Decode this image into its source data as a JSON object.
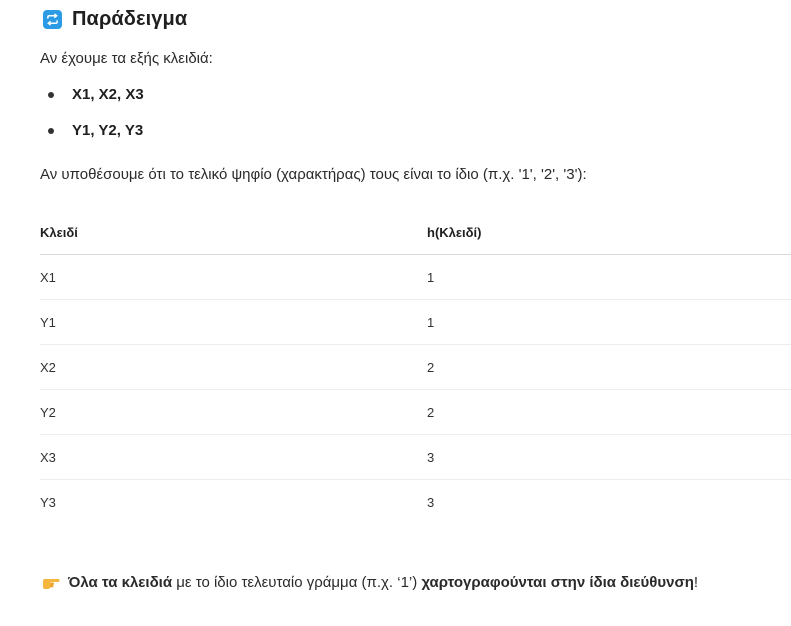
{
  "heading": {
    "icon": "repeat-icon",
    "icon_color": "#2b9be6",
    "title": "Παράδειγμα"
  },
  "intro": "Αν έχουμε τα εξής κλειδιά:",
  "bullets": [
    "X1, X2, X3",
    "Y1, Y2, Y3"
  ],
  "assumption": "Αν υποθέσουμε ότι το τελικό ψηφίο (χαρακτήρας) τους είναι το ίδιο (π.χ. '1', '2', '3'):",
  "table": {
    "headers": [
      "Κλειδί",
      "h(Κλειδί)"
    ],
    "rows": [
      [
        "X1",
        "1"
      ],
      [
        "Y1",
        "1"
      ],
      [
        "X2",
        "2"
      ],
      [
        "Y2",
        "2"
      ],
      [
        "X3",
        "3"
      ],
      [
        "Y3",
        "3"
      ]
    ]
  },
  "conclusion": {
    "icon": "pointing-hand-icon",
    "bold_start": "Όλα τα κλειδιά",
    "middle": " με το ίδιο τελευταίο γράμμα (π.χ. ‘1’) ",
    "bold_end": "χαρτογραφούνται στην ίδια διεύθυνση",
    "end": "!"
  }
}
